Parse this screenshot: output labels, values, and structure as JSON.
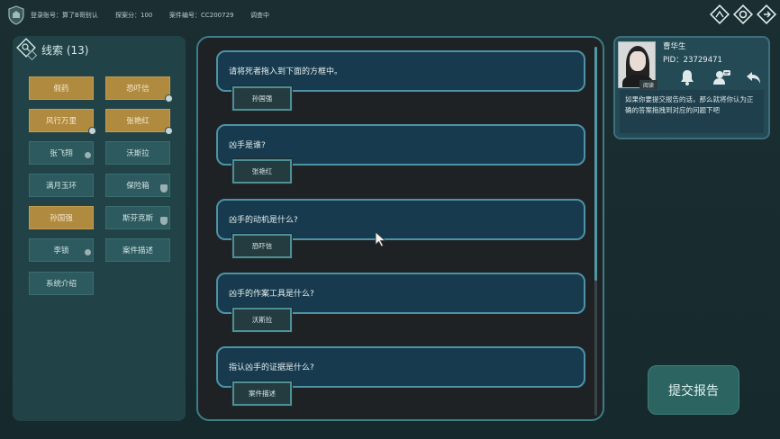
{
  "topbar": {
    "account": "登录账号：算了B哥别认",
    "score": "探案分：100",
    "case": "案件编号：CC200729",
    "status": "调查中",
    "icons": [
      "shield-logo-icon",
      "level-up-icon",
      "settings-icon",
      "exit-icon"
    ]
  },
  "clues": {
    "title": "线索 (13)",
    "items": [
      {
        "label": "假药",
        "style": "gold"
      },
      {
        "label": "恐吓信",
        "style": "gold",
        "badge": "dot"
      },
      {
        "label": "风行万里",
        "style": "gold",
        "badge": "dot"
      },
      {
        "label": "张艳红",
        "style": "gold",
        "badge": "dot"
      },
      {
        "label": "张飞翔",
        "style": "teal",
        "badge": "dot"
      },
      {
        "label": "沃斯拉",
        "style": "teal"
      },
      {
        "label": "满月玉环",
        "style": "teal"
      },
      {
        "label": "保险箱",
        "style": "teal",
        "badge": "shield"
      },
      {
        "label": "孙国强",
        "style": "gold"
      },
      {
        "label": "斯芬克斯",
        "style": "teal",
        "badge": "shield"
      },
      {
        "label": "李锁",
        "style": "teal",
        "badge": "dot"
      },
      {
        "label": "案件描述",
        "style": "teal"
      },
      {
        "label": "系统介绍",
        "style": "teal"
      }
    ]
  },
  "questions": [
    {
      "text": "请将死者拖入到下面的方框中。",
      "answer": "孙国强"
    },
    {
      "text": "凶手是谁?",
      "answer": "张艳红"
    },
    {
      "text": "凶手的动机是什么?",
      "answer": "恐吓信"
    },
    {
      "text": "凶手的作案工具是什么?",
      "answer": "沃斯拉"
    },
    {
      "text": "指认凶手的证据是什么?",
      "answer": "案件描述"
    }
  ],
  "profile": {
    "name": "曹华生",
    "pid": "PID：23729471",
    "tag": "阅读",
    "hint": "如果你要提交报告的话，那么就将你认为正确的答案拖拽到对应的问题下吧",
    "icons": [
      "bell-icon",
      "contact-icon",
      "back-arrow-icon"
    ]
  },
  "submit_label": "提交报告",
  "colors": {
    "gold": "#b08a3e",
    "teal": "#2d5a5e",
    "question_bg": "#173a4e",
    "accent_border": "#4d92a6"
  }
}
